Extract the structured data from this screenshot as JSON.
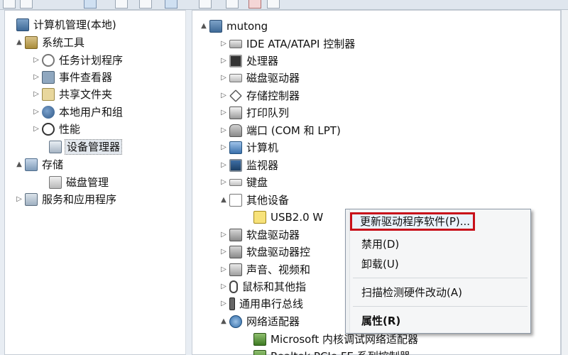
{
  "left_tree": [
    {
      "label": "计算机管理(本地)",
      "icon": "computer-management-icon",
      "expander": "",
      "selected": false
    },
    {
      "label": "系统工具",
      "icon": "system-tools-icon",
      "expander": "▲",
      "selected": false
    },
    {
      "label": "任务计划程序",
      "icon": "task-scheduler-icon",
      "expander": "▷",
      "selected": false
    },
    {
      "label": "事件查看器",
      "icon": "event-viewer-icon",
      "expander": "▷",
      "selected": false
    },
    {
      "label": "共享文件夹",
      "icon": "shared-folders-icon",
      "expander": "▷",
      "selected": false
    },
    {
      "label": "本地用户和组",
      "icon": "local-users-icon",
      "expander": "▷",
      "selected": false
    },
    {
      "label": "性能",
      "icon": "performance-icon",
      "expander": "▷",
      "selected": false
    },
    {
      "label": "设备管理器",
      "icon": "device-manager-icon",
      "expander": "",
      "selected": true
    },
    {
      "label": "存储",
      "icon": "storage-icon",
      "expander": "▲",
      "selected": false
    },
    {
      "label": "磁盘管理",
      "icon": "disk-management-icon",
      "expander": "",
      "selected": false
    },
    {
      "label": "服务和应用程序",
      "icon": "services-icon",
      "expander": "▷",
      "selected": false
    }
  ],
  "right_tree": [
    {
      "label": "mutong",
      "icon": "computer-icon",
      "expander": "▲"
    },
    {
      "label": "IDE ATA/ATAPI 控制器",
      "icon": "ide-controller-icon",
      "expander": "▷"
    },
    {
      "label": "处理器",
      "icon": "processor-icon",
      "expander": "▷"
    },
    {
      "label": "磁盘驱动器",
      "icon": "disk-drive-icon",
      "expander": "▷"
    },
    {
      "label": "存储控制器",
      "icon": "storage-controller-icon",
      "expander": "▷"
    },
    {
      "label": "打印队列",
      "icon": "printer-icon",
      "expander": "▷"
    },
    {
      "label": "端口 (COM 和 LPT)",
      "icon": "port-icon",
      "expander": "▷"
    },
    {
      "label": "计算机",
      "icon": "pc-icon",
      "expander": "▷"
    },
    {
      "label": "监视器",
      "icon": "monitor-icon",
      "expander": "▷"
    },
    {
      "label": "键盘",
      "icon": "keyboard-icon",
      "expander": "▷"
    },
    {
      "label": "其他设备",
      "icon": "other-devices-icon",
      "expander": "▲"
    },
    {
      "label": "USB2.0 W",
      "icon": "warning-device-icon",
      "expander": ""
    },
    {
      "label": "软盘驱动器",
      "icon": "floppy-drive-icon",
      "expander": "▷"
    },
    {
      "label": "软盘驱动器控",
      "icon": "floppy-controller-icon",
      "expander": "▷"
    },
    {
      "label": "声音、视频和",
      "icon": "sound-video-icon",
      "expander": "▷"
    },
    {
      "label": "鼠标和其他指",
      "icon": "mouse-icon",
      "expander": "▷"
    },
    {
      "label": "通用串行总线",
      "icon": "usb-controller-icon",
      "expander": "▷"
    },
    {
      "label": "网络适配器",
      "icon": "network-adapter-icon",
      "expander": "▲"
    },
    {
      "label": "Microsoft 内核调试网络适配器",
      "icon": "nic-icon",
      "expander": ""
    },
    {
      "label": "Realtek PCIe FE 系列控制器",
      "icon": "nic-icon",
      "expander": ""
    }
  ],
  "context_menu": {
    "items": [
      {
        "label": "更新驱动程序软件(P)...",
        "highlighted": true,
        "bold": false
      },
      {
        "label": "禁用(D)",
        "highlighted": false,
        "bold": false
      },
      {
        "label": "卸载(U)",
        "highlighted": false,
        "bold": false
      },
      {
        "label": "扫描检测硬件改动(A)",
        "highlighted": false,
        "bold": false
      },
      {
        "label": "属性(R)",
        "highlighted": false,
        "bold": true
      }
    ]
  },
  "colors": {
    "highlight_border": "#c8101a",
    "selection_bg": "#e3e8ee",
    "window_bg": "#ffffff"
  }
}
